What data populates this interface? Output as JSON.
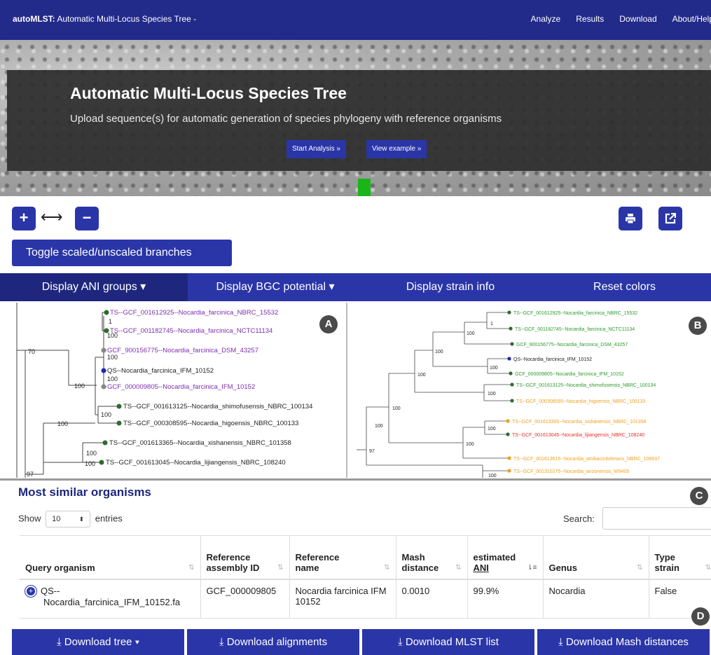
{
  "navbar": {
    "brand_bold": "autoMLST:",
    "brand_rest": " Automatic Multi-Locus Species Tree -",
    "links": [
      "Analyze",
      "Results",
      "Download",
      "About/Help"
    ]
  },
  "hero": {
    "title": "Automatic Multi-Locus Species Tree",
    "subtitle": "Upload sequence(s) for automatic generation of species phylogeny with reference organisms",
    "start_button": "Start Analysis »",
    "example_button": "View example »"
  },
  "toolbar": {
    "zoom_in": "+",
    "zoom_out": "−",
    "resize_icon": "⟷",
    "toggle_label": "Toggle scaled/unscaled branches"
  },
  "display_bar": {
    "ani": "Display ANI groups ▾",
    "bgc": "Display BGC potential ▾",
    "strain": "Display strain info",
    "reset": "Reset colors"
  },
  "panel_labels": {
    "a": "A",
    "b": "B",
    "c": "C",
    "d": "D"
  },
  "colors": {
    "navbar": "#222a8a",
    "button": "#2a35a8",
    "purple_leaf": "#7d2db0",
    "green_leaf": "#2d9a2d",
    "orange_leaf": "#f0a020",
    "red_leaf": "#e0302a",
    "node": "#2e6b2e",
    "query_node": "#1e2ab0",
    "arrow": "#19b519"
  },
  "tree_a": {
    "leaves": [
      "TS--GCF_001612925--Nocardia_farcinica_NBRC_15532",
      "TS--GCF_001182745--Nocardia_farcinica_NCTC11134",
      "GCF_900156775--Nocardia_farcinica_DSM_43257",
      "QS--Nocardia_farcinica_IFM_10152",
      "GCF_000009805--Nocardia_farcinica_IFM_10152",
      "TS--GCF_001613125--Nocardia_shimofusensis_NBRC_100134",
      "TS--GCF_000308595--Nocardia_higoensis_NBRC_100133",
      "TS--GCF_001613365--Nocardia_xishanensis_NBRC_101358",
      "TS--GCF_001613045--Nocardia_lijiangensis_NBRC_108240"
    ],
    "support": [
      "1",
      "100",
      "100",
      "100",
      "70",
      "100",
      "100",
      "100",
      "100",
      "100",
      "97"
    ]
  },
  "tree_b": {
    "leaves": [
      "TS--GCF_001612925--Nocardia_farcinica_NBRC_15532",
      "TS--GCF_001182745--Nocardia_farcinica_NCTC11134",
      "GCF_900156775--Nocardia_farcinica_DSM_43257",
      "QS--Nocardia_farcinica_IFM_10152",
      "GCF_000009805--Nocardia_farcinica_IFM_10152",
      "TS--GCF_001613125--Nocardia_shimofusensis_NBRC_100134",
      "TS--GCF_000308595--Nocardia_higoensis_NBRC_100133",
      "TS--GCF_001613365--Nocardia_xishanensis_NBRC_101358",
      "TS--GCF_001613045--Nocardia_lijiangensis_NBRC_108240",
      "TS--GCF_001613615--Nocardia_amikacinitolerans_NBRC_108937",
      "TS--GCF_001310275--Nocardia_arizonensis_W9405"
    ],
    "support": [
      "1",
      "100",
      "100",
      "100",
      "100",
      "100",
      "100",
      "100",
      "100",
      "100",
      "97",
      "100"
    ]
  },
  "similar": {
    "title": "Most similar organisms",
    "show": "Show",
    "entries_value": "10",
    "entries": "entries",
    "search": "Search:",
    "headers": [
      "Query organism",
      "Reference assembly ID",
      "Reference name",
      "Mash distance",
      "estimated",
      "ANI",
      "Genus",
      "Type strain"
    ],
    "row": {
      "query_line1": "QS--",
      "query_line2": "Nocardia_farcinica_IFM_10152.fa",
      "assembly": "GCF_000009805",
      "name": "Nocardia farcinica IFM 10152",
      "mash": "0.0010",
      "ani": "99.9%",
      "genus": "Nocardia",
      "type_strain": "False"
    }
  },
  "downloads": {
    "tree": "⤓ Download tree ▾",
    "alignments": "⤓ Download alignments",
    "mlst": "⤓ Download MLST list",
    "mash": "⤓ Download Mash distances"
  }
}
